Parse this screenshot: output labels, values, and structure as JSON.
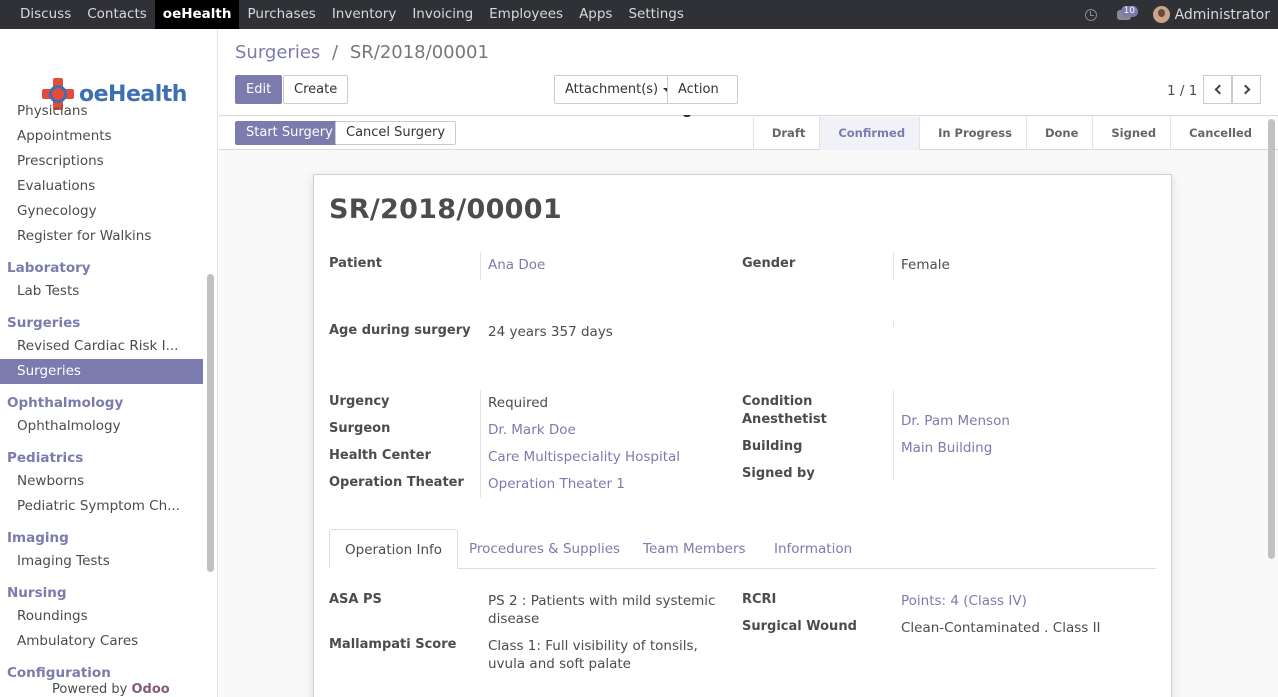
{
  "topbar": {
    "menu": [
      "Discuss",
      "Contacts",
      "oeHealth",
      "Purchases",
      "Inventory",
      "Invoicing",
      "Employees",
      "Apps",
      "Settings"
    ],
    "active_menu": "oeHealth",
    "chat_count": "10",
    "user": "Administrator"
  },
  "sidebar": {
    "logo_text": "oeHealth",
    "top_items": [
      "Physicians",
      "Appointments",
      "Prescriptions",
      "Evaluations",
      "Gynecology",
      "Register for Walkins"
    ],
    "sections": [
      {
        "title": "Laboratory",
        "items": [
          "Lab Tests"
        ]
      },
      {
        "title": "Surgeries",
        "items": [
          "Revised Cardiac Risk I...",
          "Surgeries"
        ]
      },
      {
        "title": "Ophthalmology",
        "items": [
          "Ophthalmology"
        ]
      },
      {
        "title": "Pediatrics",
        "items": [
          "Newborns",
          "Pediatric Symptom Ch..."
        ]
      },
      {
        "title": "Imaging",
        "items": [
          "Imaging Tests"
        ]
      },
      {
        "title": "Nursing",
        "items": [
          "Roundings",
          "Ambulatory Cares"
        ]
      },
      {
        "title": "Configuration",
        "items": []
      }
    ],
    "active_item": "Surgeries",
    "powered_by": "Powered by",
    "powered_brand": "Odoo"
  },
  "control_panel": {
    "breadcrumb_parent": "Surgeries",
    "breadcrumb_sep": "/",
    "breadcrumb_current": "SR/2018/00001",
    "edit_label": "Edit",
    "create_label": "Create",
    "attachments_label": "Attachment(s)",
    "action_label": "Action",
    "pager": "1 / 1"
  },
  "statusbar": {
    "start_label": "Start Surgery",
    "cancel_label": "Cancel Surgery",
    "stages": [
      "Draft",
      "Confirmed",
      "In Progress",
      "Done",
      "Signed",
      "Cancelled"
    ],
    "current_stage": "Confirmed"
  },
  "form": {
    "title": "SR/2018/00001",
    "patient_label": "Patient",
    "patient": "Ana Doe",
    "gender_label": "Gender",
    "gender": "Female",
    "age_label": "Age during surgery",
    "age": "24 years 357 days",
    "urgency_label": "Urgency",
    "urgency": "Required",
    "surgeon_label": "Surgeon",
    "surgeon": "Dr. Mark Doe",
    "health_center_label": "Health Center",
    "health_center": "Care Multispeciality Hospital",
    "theater_label": "Operation Theater",
    "theater": "Operation Theater 1",
    "condition_label": "Condition",
    "anesthetist_label": "Anesthetist",
    "anesthetist": "Dr. Pam Menson",
    "building_label": "Building",
    "building": "Main Building",
    "signed_by_label": "Signed by",
    "tabs": [
      "Operation Info",
      "Procedures & Supplies",
      "Team Members",
      "Information"
    ],
    "active_tab": "Operation Info",
    "asa_label": "ASA PS",
    "asa_line1": "PS 2 : Patients with mild systemic",
    "asa_line2": "disease",
    "mallampati_label": "Mallampati Score",
    "mallampati_line1": "Class 1: Full visibility of tonsils,",
    "mallampati_line2": "uvula and soft palate",
    "rcri_label": "RCRI",
    "rcri": "Points: 4 (Class IV)",
    "wound_label": "Surgical Wound",
    "wound": "Clean-Contaminated . Class II"
  },
  "colors": {
    "accent": "#7c7bad",
    "topbar": "#2f3136",
    "brand_red": "#e64a3b",
    "brand_blue": "#3d6fb3"
  }
}
